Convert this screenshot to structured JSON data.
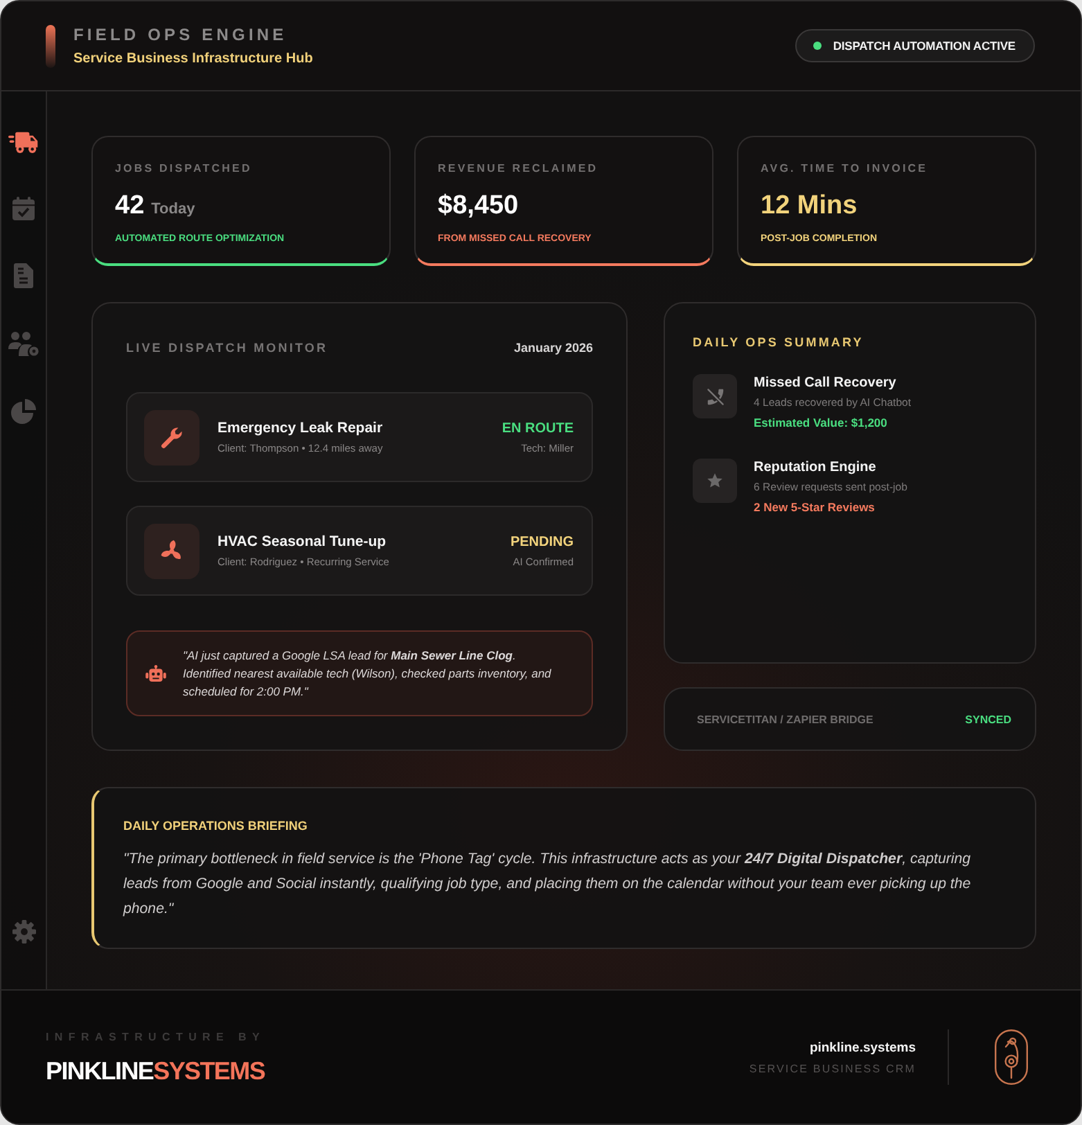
{
  "header": {
    "title": "FIELD OPS ENGINE",
    "subtitle": "Service Business Infrastructure Hub",
    "status": {
      "label": "DISPATCH AUTOMATION ACTIVE",
      "on": true
    }
  },
  "sidebar": {
    "items": [
      {
        "selected": true
      },
      {
        "selected": false
      },
      {
        "selected": false
      },
      {
        "selected": false
      },
      {
        "selected": false
      }
    ]
  },
  "stats": [
    {
      "label": "JOBS DISPATCHED",
      "value": "42",
      "unit": "Today",
      "note": "AUTOMATED ROUTE OPTIMIZATION",
      "color": "#4ade80",
      "highlight": false
    },
    {
      "label": "REVENUE RECLAIMED",
      "value": "$8,450",
      "note": "FROM MISSED CALL RECOVERY",
      "color": "#f47a5e",
      "highlight": false
    },
    {
      "label": "AVG. TIME TO INVOICE",
      "value": "12 Mins",
      "note": "POST-JOB COMPLETION",
      "color": "#f2d37c",
      "highlight": true
    }
  ],
  "dispatch_monitor": {
    "title": "LIVE DISPATCH MONITOR",
    "date": "January 2026",
    "jobs": [
      {
        "title": "Emergency Leak Repair",
        "detail": "Client: Thompson • 12.4 miles away",
        "status": "EN ROUTE",
        "color": "#4ade80",
        "assignee": "Tech: Miller"
      },
      {
        "title": "HVAC Seasonal Tune-up",
        "detail": "Client: Rodriguez • Recurring Service",
        "status": "PENDING",
        "color": "#f2d37c",
        "assignee": "AI Confirmed"
      }
    ],
    "ai_note": "\"AI just captured a Google LSA lead for **Main Sewer Line Clog**. Identified nearest available tech (Wilson), checked parts inventory, and scheduled for 2:00 PM.\""
  },
  "daily_summary": {
    "title": "DAILY OPS SUMMARY",
    "items": [
      {
        "title": "Missed Call Recovery",
        "detail": "4 Leads recovered by AI Chatbot",
        "highlight": "Estimated Value: $1,200",
        "color": "#4ade80"
      },
      {
        "title": "Reputation Engine",
        "detail": "6 Review requests sent post-job",
        "highlight": "2 New 5-Star Reviews",
        "color": "#f47a5e"
      }
    ]
  },
  "bridge": {
    "label": "SERVICETITAN / ZAPIER BRIDGE",
    "status": "SYNCED"
  },
  "briefing": {
    "title": "DAILY OPERATIONS BRIEFING",
    "text": "\"The primary bottleneck in field service is the 'Phone Tag' cycle. This infrastructure acts as your **24/7 Digital Dispatcher**, capturing leads from Google and Social instantly, qualifying job type, and placing them on the calendar without your team ever picking up the phone.\""
  },
  "footer": {
    "label": "INFRASTRUCTURE BY",
    "brand": {
      "primary": "PINKLINE",
      "accent": "SYSTEMS"
    },
    "site": "pinkline.systems",
    "tagline": "SERVICE BUSINESS CRM"
  }
}
